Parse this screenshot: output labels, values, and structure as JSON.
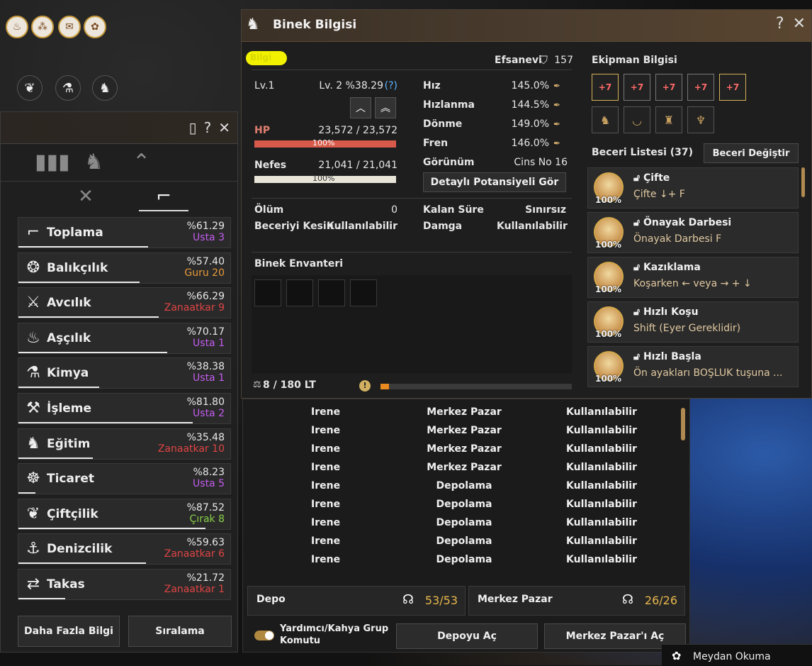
{
  "top_icons": [
    "cake-icon",
    "share-icon",
    "scroll-icon",
    "gear-icon"
  ],
  "top_dark_icons": [
    "butterfly-icon",
    "potion-icon",
    "horse-head-icon"
  ],
  "life_panel": {
    "subtabs": [
      "combat-icon",
      "gathering-icon"
    ],
    "skills": [
      {
        "icon": "sickle-icon",
        "name": "Toplama",
        "pct": "%61.29",
        "level": "Usta 3",
        "level_color": "#c45cf0",
        "bar": 0.61
      },
      {
        "icon": "fish-icon",
        "name": "Balıkçılık",
        "pct": "%57.40",
        "level": "Guru 20",
        "level_color": "#e89a3a",
        "bar": 0.57
      },
      {
        "icon": "knife-icon",
        "name": "Avcılık",
        "pct": "%66.29",
        "level": "Zanaatkar 9",
        "level_color": "#e04444",
        "bar": 0.66
      },
      {
        "icon": "pot-icon",
        "name": "Aşçılık",
        "pct": "%70.17",
        "level": "Usta 1",
        "level_color": "#c45cf0",
        "bar": 0.7
      },
      {
        "icon": "flask-icon",
        "name": "Kimya",
        "pct": "%38.38",
        "level": "Usta 1",
        "level_color": "#c45cf0",
        "bar": 0.38
      },
      {
        "icon": "hammer-icon",
        "name": "İşleme",
        "pct": "%81.80",
        "level": "Usta 2",
        "level_color": "#c45cf0",
        "bar": 0.82
      },
      {
        "icon": "horse-icon",
        "name": "Eğitim",
        "pct": "%35.48",
        "level": "Zanaatkar 10",
        "level_color": "#e04444",
        "bar": 0.35
      },
      {
        "icon": "wheel-icon",
        "name": "Ticaret",
        "pct": "%8.23",
        "level": "Usta 5",
        "level_color": "#c45cf0",
        "bar": 0.08
      },
      {
        "icon": "sprout-icon",
        "name": "Çiftçilik",
        "pct": "%87.52",
        "level": "Çırak 8",
        "level_color": "#88d048",
        "bar": 0.88
      },
      {
        "icon": "anchor-icon",
        "name": "Denizcilik",
        "pct": "%59.63",
        "level": "Zanaatkar 6",
        "level_color": "#e04444",
        "bar": 0.6
      },
      {
        "icon": "exchange-icon",
        "name": "Takas",
        "pct": "%21.72",
        "level": "Zanaatkar 1",
        "level_color": "#e04444",
        "bar": 0.22
      }
    ],
    "more_info": "Daha Fazla Bilgi",
    "ranking": "Sıralama"
  },
  "mount": {
    "title": "Binek Bilgisi",
    "name": "Bilgi",
    "grade": "Efsanevi",
    "score": "157",
    "level_label": "Lv.1",
    "level_value": "Lv. 2 %38.29",
    "help": "(?)",
    "hp_label": "HP",
    "hp_value": "23,572 / 23,572",
    "hp_pct": "100%",
    "stam_label": "Nefes",
    "stam_value": "21,041 / 21,041",
    "stam_pct": "100%",
    "stats": [
      {
        "label": "Hız",
        "value": "145.0%"
      },
      {
        "label": "Hızlanma",
        "value": "144.5%"
      },
      {
        "label": "Dönme",
        "value": "149.0%"
      },
      {
        "label": "Fren",
        "value": "146.0%"
      }
    ],
    "appearance_label": "Görünüm",
    "appearance_value": "Cins No 16",
    "potential_btn": "Detaylı Potansiyeli Gör",
    "death_label": "Ölüm",
    "death_value": "0",
    "skill_learn_label": "Beceriyi Kesin ...",
    "skill_learn_value": "Kullanılabilir",
    "time_label": "Kalan Süre",
    "time_value": "Sınırsız",
    "stamp_label": "Damga",
    "stamp_value": "Kullanılabilir",
    "inventory_label": "Binek Envanteri",
    "weight": "8 / 180 LT",
    "equip_title": "Ekipman Bilgisi",
    "equip_upper": [
      "+7",
      "+7",
      "+7",
      "+7",
      "+7"
    ],
    "skill_title": "Beceri Listesi (37)",
    "skill_change_btn": "Beceri Değiştir",
    "skills": [
      {
        "name": "Çifte",
        "key": "Çifte ↓+ F",
        "pct": "100%"
      },
      {
        "name": "Önayak Darbesi",
        "key": "Önayak Darbesi F",
        "pct": "100%"
      },
      {
        "name": "Kazıklama",
        "key": "Koşarken ← veya → + ↓",
        "pct": "100%"
      },
      {
        "name": "Hızlı Koşu",
        "key": "Shift (Eyer Gereklidir)",
        "pct": "100%"
      },
      {
        "name": "Hızlı Başla",
        "key": "Ön ayakları BOŞLUK tuşuna ...",
        "pct": "100%"
      }
    ]
  },
  "list": {
    "rows": [
      {
        "name": "Irene",
        "loc": "Merkez Pazar",
        "status": "Kullanılabilir"
      },
      {
        "name": "Irene",
        "loc": "Merkez Pazar",
        "status": "Kullanılabilir"
      },
      {
        "name": "Irene",
        "loc": "Merkez Pazar",
        "status": "Kullanılabilir"
      },
      {
        "name": "Irene",
        "loc": "Merkez Pazar",
        "status": "Kullanılabilir"
      },
      {
        "name": "Irene",
        "loc": "Depolama",
        "status": "Kullanılabilir"
      },
      {
        "name": "Irene",
        "loc": "Depolama",
        "status": "Kullanılabilir"
      },
      {
        "name": "Irene",
        "loc": "Depolama",
        "status": "Kullanılabilir"
      },
      {
        "name": "Irene",
        "loc": "Depolama",
        "status": "Kullanılabilir"
      },
      {
        "name": "Irene",
        "loc": "Depolama",
        "status": "Kullanılabilir"
      }
    ],
    "depot_label": "Depo",
    "depot_value": "53/53",
    "market_label": "Merkez Pazar",
    "market_value": "26/26",
    "group_cmd": "Yardımcı/Kahya Grup Komutu",
    "open_depot": "Depoyu Aç",
    "open_market": "Merkez Pazar'ı Aç"
  },
  "meydan": "Meydan Okuma"
}
